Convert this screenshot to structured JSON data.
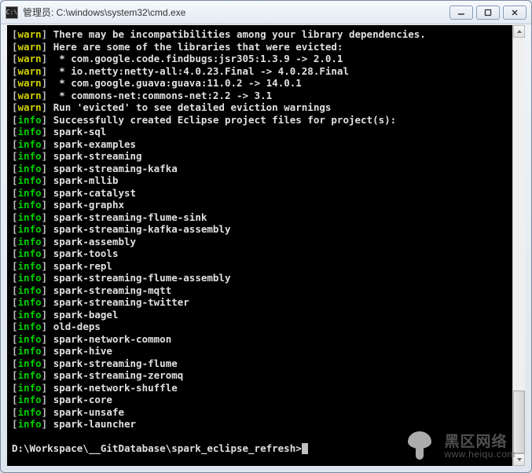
{
  "titlebar": {
    "icon_glyph": "C:\\",
    "text": "管理员: C:\\windows\\system32\\cmd.exe"
  },
  "lines": [
    {
      "lvl": "warn",
      "msg": "There may be incompatibilities among your library dependencies."
    },
    {
      "lvl": "warn",
      "msg": "Here are some of the libraries that were evicted:"
    },
    {
      "lvl": "warn",
      "msg": " * com.google.code.findbugs:jsr305:1.3.9 -> 2.0.1"
    },
    {
      "lvl": "warn",
      "msg": " * io.netty:netty-all:4.0.23.Final -> 4.0.28.Final"
    },
    {
      "lvl": "warn",
      "msg": " * com.google.guava:guava:11.0.2 -> 14.0.1"
    },
    {
      "lvl": "warn",
      "msg": " * commons-net:commons-net:2.2 -> 3.1"
    },
    {
      "lvl": "warn",
      "msg": "Run 'evicted' to see detailed eviction warnings"
    },
    {
      "lvl": "info",
      "msg": "Successfully created Eclipse project files for project(s):"
    },
    {
      "lvl": "info",
      "msg": "spark-sql"
    },
    {
      "lvl": "info",
      "msg": "spark-examples"
    },
    {
      "lvl": "info",
      "msg": "spark-streaming"
    },
    {
      "lvl": "info",
      "msg": "spark-streaming-kafka"
    },
    {
      "lvl": "info",
      "msg": "spark-mllib"
    },
    {
      "lvl": "info",
      "msg": "spark-catalyst"
    },
    {
      "lvl": "info",
      "msg": "spark-graphx"
    },
    {
      "lvl": "info",
      "msg": "spark-streaming-flume-sink"
    },
    {
      "lvl": "info",
      "msg": "spark-streaming-kafka-assembly"
    },
    {
      "lvl": "info",
      "msg": "spark-assembly"
    },
    {
      "lvl": "info",
      "msg": "spark-tools"
    },
    {
      "lvl": "info",
      "msg": "spark-repl"
    },
    {
      "lvl": "info",
      "msg": "spark-streaming-flume-assembly"
    },
    {
      "lvl": "info",
      "msg": "spark-streaming-mqtt"
    },
    {
      "lvl": "info",
      "msg": "spark-streaming-twitter"
    },
    {
      "lvl": "info",
      "msg": "spark-bagel"
    },
    {
      "lvl": "info",
      "msg": "old-deps"
    },
    {
      "lvl": "info",
      "msg": "spark-network-common"
    },
    {
      "lvl": "info",
      "msg": "spark-hive"
    },
    {
      "lvl": "info",
      "msg": "spark-streaming-flume"
    },
    {
      "lvl": "info",
      "msg": "spark-streaming-zeromq"
    },
    {
      "lvl": "info",
      "msg": "spark-network-shuffle"
    },
    {
      "lvl": "info",
      "msg": "spark-core"
    },
    {
      "lvl": "info",
      "msg": "spark-unsafe"
    },
    {
      "lvl": "info",
      "msg": "spark-launcher"
    }
  ],
  "prompt": "D:\\Workspace\\__GitDatabase\\spark_eclipse_refresh>",
  "watermark": {
    "cn": "黑区网络",
    "url": "www.heiqu.com"
  }
}
